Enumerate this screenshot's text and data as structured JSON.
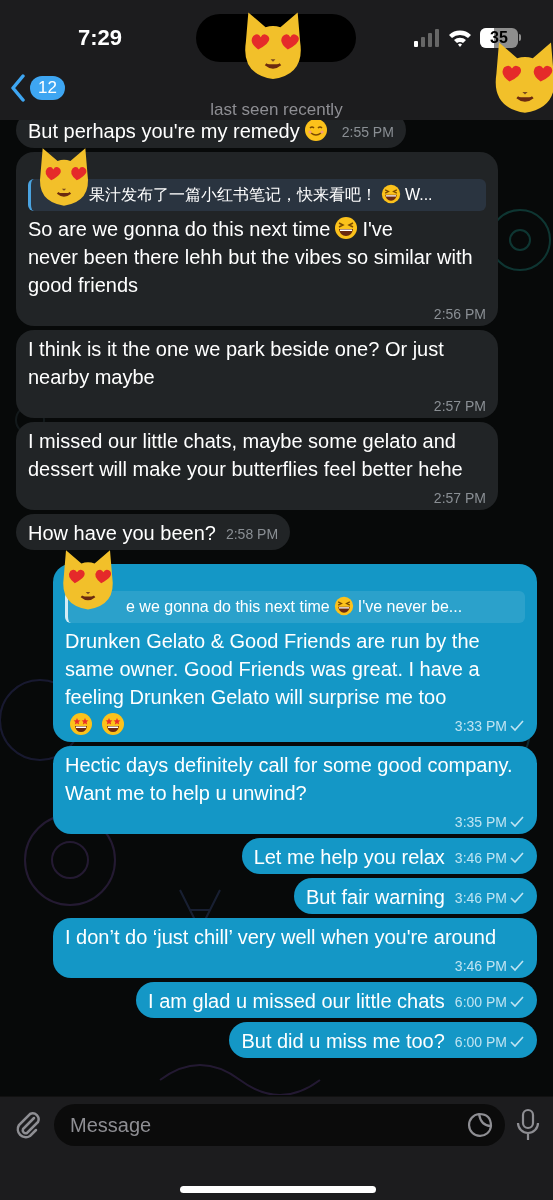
{
  "status_bar": {
    "time": "7:29",
    "battery": "35"
  },
  "header": {
    "back_badge": "12",
    "subtitle": "last seen recently"
  },
  "messages": [
    {
      "outgoing": false,
      "parts": [
        {
          "kind": "text",
          "text": "But perhaps you're my remedy"
        },
        {
          "kind": "smile-emoji"
        }
      ],
      "time": "2:55 PM"
    },
    {
      "outgoing": false,
      "reply": [
        {
          "kind": "text",
          "text": "果汁发布了一篇小红书笔记，快来看吧！"
        },
        {
          "kind": "laugh-emoji"
        },
        {
          "kind": "text",
          "text": "W..."
        }
      ],
      "parts": [
        {
          "kind": "text",
          "text": "So are we gonna do this next time"
        },
        {
          "kind": "laugh-emoji"
        },
        {
          "kind": "text",
          "text": "I've"
        },
        {
          "kind": "text",
          "text": "never been there lehh but the vibes so similar with good friends"
        }
      ],
      "time": "2:56 PM"
    },
    {
      "outgoing": false,
      "parts": [
        {
          "kind": "text",
          "text": "I think is it the one we park beside one? Or just nearby maybe"
        }
      ],
      "time": "2:57 PM"
    },
    {
      "outgoing": false,
      "parts": [
        {
          "kind": "text",
          "text": "I missed our little chats, maybe some gelato and dessert will make your butterflies feel better hehe"
        }
      ],
      "time": "2:57 PM"
    },
    {
      "outgoing": false,
      "parts": [
        {
          "kind": "text",
          "text": "How have you been?"
        }
      ],
      "time": "2:58 PM"
    },
    {
      "outgoing": true,
      "read": false,
      "reply": [
        {
          "kind": "text",
          "text": "e we gonna do this next time"
        },
        {
          "kind": "laugh-emoji"
        },
        {
          "kind": "text",
          "text": "I've never be..."
        }
      ],
      "parts": [
        {
          "kind": "text",
          "text": "Drunken Gelato & Good Friends are run by the same owner. Good Friends was great. I have a feeling Drunken Gelato will surprise me too"
        },
        {
          "kind": "star-eyes-emoji"
        },
        {
          "kind": "star-eyes-emoji"
        }
      ],
      "time": "3:33 PM"
    },
    {
      "outgoing": true,
      "read": false,
      "parts": [
        {
          "kind": "text",
          "text": "Hectic days definitely call for some good company. Want me to help u unwind?"
        }
      ],
      "time": "3:35 PM"
    },
    {
      "outgoing": true,
      "read": false,
      "parts": [
        {
          "kind": "text",
          "text": "Let me help you relax"
        }
      ],
      "time": "3:46 PM"
    },
    {
      "outgoing": true,
      "read": false,
      "parts": [
        {
          "kind": "text",
          "text": "But fair warning"
        }
      ],
      "time": "3:46 PM"
    },
    {
      "outgoing": true,
      "read": false,
      "parts": [
        {
          "kind": "text",
          "text": "I don’t do ‘just chill’ very well when you're around"
        }
      ],
      "time": "3:46 PM"
    },
    {
      "outgoing": true,
      "read": false,
      "parts": [
        {
          "kind": "text",
          "text": "I am glad u missed our little chats"
        }
      ],
      "time": "6:00 PM"
    },
    {
      "outgoing": true,
      "read": false,
      "parts": [
        {
          "kind": "text",
          "text": "But did u miss me too?"
        }
      ],
      "time": "6:00 PM"
    }
  ],
  "composer": {
    "placeholder": "Message"
  }
}
